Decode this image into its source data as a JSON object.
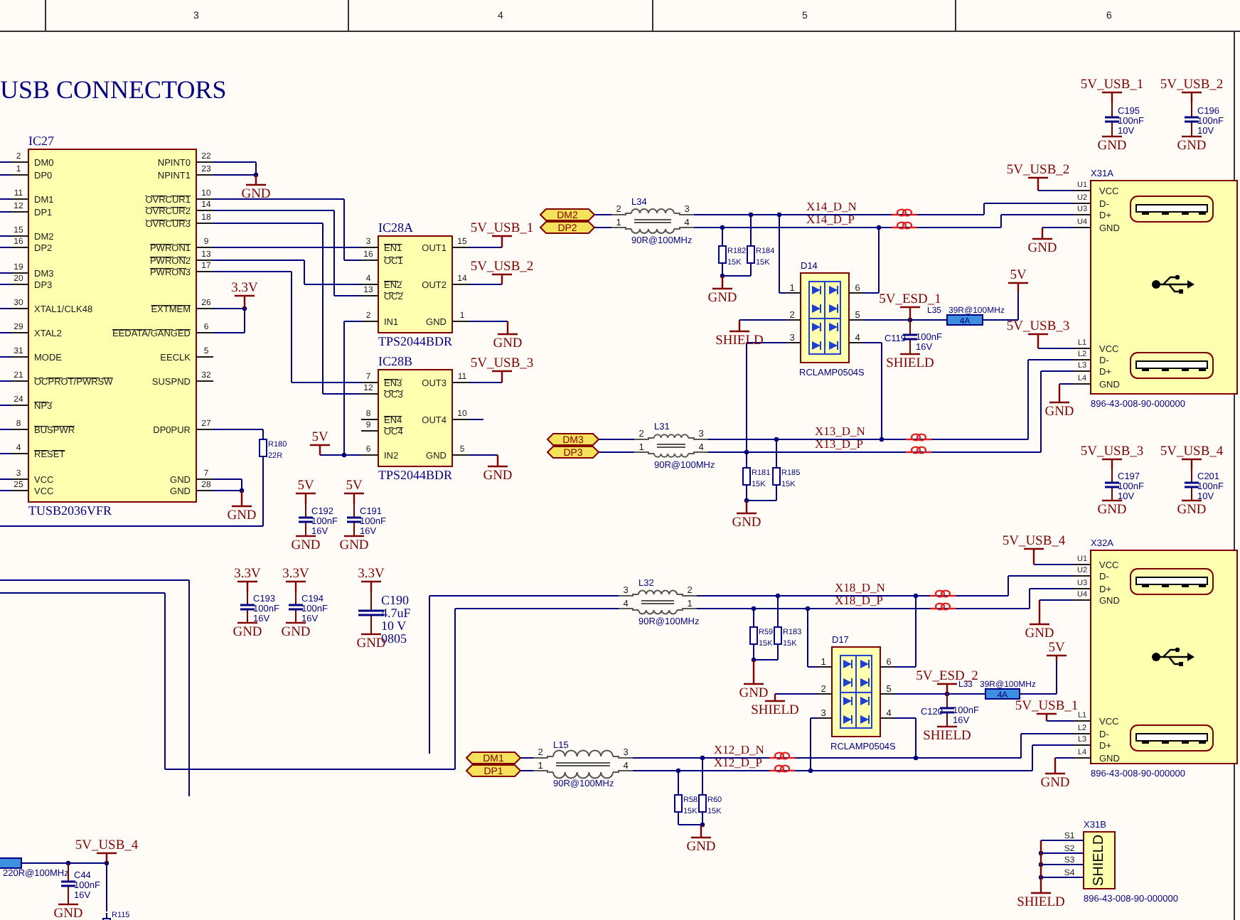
{
  "frame": {
    "column_numbers": [
      "3",
      "4",
      "5",
      "6"
    ]
  },
  "title": "USB CONNECTORS",
  "ics": [
    {
      "designator": "IC27",
      "part_number": "TUSB2036VFR",
      "left_pins": [
        {
          "number": "2",
          "name": "DM0",
          "inverted": false
        },
        {
          "number": "1",
          "name": "DP0",
          "inverted": false
        },
        {
          "number": "11",
          "name": "DM1",
          "inverted": false
        },
        {
          "number": "12",
          "name": "DP1",
          "inverted": false
        },
        {
          "number": "15",
          "name": "DM2",
          "inverted": false
        },
        {
          "number": "16",
          "name": "DP2",
          "inverted": false
        },
        {
          "number": "19",
          "name": "DM3",
          "inverted": false
        },
        {
          "number": "20",
          "name": "DP3",
          "inverted": false
        },
        {
          "number": "30",
          "name": "XTAL1/CLK48",
          "inverted": false
        },
        {
          "number": "29",
          "name": "XTAL2",
          "inverted": false
        },
        {
          "number": "31",
          "name": "MODE",
          "inverted": false
        },
        {
          "number": "21",
          "name": "OCPROT/PWRSW",
          "inverted": true
        },
        {
          "number": "24",
          "name": "NP3",
          "inverted": true
        },
        {
          "number": "8",
          "name": "BUSPWR",
          "inverted": true
        },
        {
          "number": "4",
          "name": "RESET",
          "inverted": true
        },
        {
          "number": "3",
          "name": "VCC",
          "inverted": false
        },
        {
          "number": "25",
          "name": "VCC",
          "inverted": false
        }
      ],
      "right_pins": [
        {
          "number": "22",
          "name": "NPINT0",
          "inverted": false
        },
        {
          "number": "23",
          "name": "NPINT1",
          "inverted": false
        },
        {
          "number": "10",
          "name": "OVRCUR1",
          "inverted": true
        },
        {
          "number": "14",
          "name": "OVRCUR2",
          "inverted": true
        },
        {
          "number": "18",
          "name": "OVRCUR3",
          "inverted": true
        },
        {
          "number": "9",
          "name": "PWRON1",
          "inverted": true
        },
        {
          "number": "13",
          "name": "PWRON2",
          "inverted": true
        },
        {
          "number": "17",
          "name": "PWRON3",
          "inverted": true
        },
        {
          "number": "26",
          "name": "EXTMEM",
          "inverted": true
        },
        {
          "number": "6",
          "name": "EEDATA/GANGED",
          "inverted": true
        },
        {
          "number": "5",
          "name": "EECLK",
          "inverted": false
        },
        {
          "number": "32",
          "name": "SUSPND",
          "inverted": false
        },
        {
          "number": "27",
          "name": "DP0PUR",
          "inverted": false
        },
        {
          "number": "7",
          "name": "GND",
          "inverted": false
        },
        {
          "number": "28",
          "name": "GND",
          "inverted": false
        }
      ]
    },
    {
      "designator": "IC28A",
      "part_number": "TPS2044BDR",
      "left_pins": [
        {
          "number": "3",
          "name": "EN1",
          "inverted": true
        },
        {
          "number": "16",
          "name": "OC1",
          "inverted": true
        },
        {
          "number": "4",
          "name": "EN2",
          "inverted": true
        },
        {
          "number": "13",
          "name": "OC2",
          "inverted": true
        },
        {
          "number": "2",
          "name": "IN1",
          "inverted": false
        }
      ],
      "right_pins": [
        {
          "number": "15",
          "name": "OUT1",
          "inverted": false
        },
        {
          "number": "14",
          "name": "OUT2",
          "inverted": false
        },
        {
          "number": "1",
          "name": "GND",
          "inverted": false
        }
      ]
    },
    {
      "designator": "IC28B",
      "part_number": "TPS2044BDR",
      "left_pins": [
        {
          "number": "7",
          "name": "EN3",
          "inverted": true
        },
        {
          "number": "12",
          "name": "OC3",
          "inverted": true
        },
        {
          "number": "8",
          "name": "EN4",
          "inverted": true
        },
        {
          "number": "9",
          "name": "OC4",
          "inverted": true
        },
        {
          "number": "6",
          "name": "IN2",
          "inverted": false
        }
      ],
      "right_pins": [
        {
          "number": "11",
          "name": "OUT3",
          "inverted": false
        },
        {
          "number": "10",
          "name": "OUT4",
          "inverted": false
        },
        {
          "number": "5",
          "name": "GND",
          "inverted": false
        }
      ]
    }
  ],
  "connectors": [
    {
      "designator": "X31A",
      "part_number": "896-43-008-90-000000",
      "pins": [
        {
          "number": "U1",
          "name": "VCC"
        },
        {
          "number": "U2",
          "name": "D-"
        },
        {
          "number": "U3",
          "name": "D+"
        },
        {
          "number": "U4",
          "name": "GND"
        },
        {
          "number": "L1",
          "name": "VCC"
        },
        {
          "number": "L2",
          "name": "D-"
        },
        {
          "number": "L3",
          "name": "D+"
        },
        {
          "number": "L4",
          "name": "GND"
        }
      ]
    },
    {
      "designator": "X32A",
      "part_number": "896-43-008-90-000000",
      "pins": [
        {
          "number": "U1",
          "name": "VCC"
        },
        {
          "number": "U2",
          "name": "D-"
        },
        {
          "number": "U3",
          "name": "D+"
        },
        {
          "number": "U4",
          "name": "GND"
        },
        {
          "number": "L1",
          "name": "VCC"
        },
        {
          "number": "L2",
          "name": "D-"
        },
        {
          "number": "L3",
          "name": "D+"
        },
        {
          "number": "L4",
          "name": "GND"
        }
      ]
    }
  ],
  "shield_connector": {
    "designator": "X31B",
    "part_number": "896-43-008-90-000000",
    "body_label": "SHIELD",
    "pins": [
      "S1",
      "S2",
      "S3",
      "S4"
    ]
  },
  "chokes": [
    {
      "designator": "L34",
      "value": "90R@100MHz",
      "pins": [
        "2",
        "1",
        "3",
        "4"
      ]
    },
    {
      "designator": "L31",
      "value": "90R@100MHz",
      "pins": [
        "2",
        "1",
        "3",
        "4"
      ]
    },
    {
      "designator": "L32",
      "value": "90R@100MHz",
      "pins": [
        "3",
        "4",
        "2",
        "1"
      ]
    },
    {
      "designator": "L15",
      "value": "90R@100MHz",
      "pins": [
        "2",
        "1",
        "3",
        "4"
      ]
    }
  ],
  "beads": [
    {
      "designator": "L35",
      "value": "39R@100MHz",
      "rating": "4A"
    },
    {
      "designator": "L33",
      "value": "39R@100MHz",
      "rating": "4A"
    },
    {
      "value": "220R@100MHz"
    }
  ],
  "resistors": [
    {
      "designator": "R180",
      "value": "22R"
    },
    {
      "designator": "R182",
      "value": "15K"
    },
    {
      "designator": "R184",
      "value": "15K"
    },
    {
      "designator": "R181",
      "value": "15K"
    },
    {
      "designator": "R185",
      "value": "15K"
    },
    {
      "designator": "R59",
      "value": "15K"
    },
    {
      "designator": "R183",
      "value": "15K"
    },
    {
      "designator": "R58",
      "value": "15K"
    },
    {
      "designator": "R60",
      "value": "15K"
    },
    {
      "designator": "R115"
    }
  ],
  "capacitors": [
    {
      "designator": "C195",
      "value": "100nF",
      "voltage": "10V"
    },
    {
      "designator": "C196",
      "value": "100nF",
      "voltage": "10V"
    },
    {
      "designator": "C192",
      "value": "100nF",
      "voltage": "16V"
    },
    {
      "designator": "C191",
      "value": "100nF",
      "voltage": "16V"
    },
    {
      "designator": "C193",
      "value": "100nF",
      "voltage": "16V"
    },
    {
      "designator": "C194",
      "value": "100nF",
      "voltage": "16V"
    },
    {
      "designator": "C190",
      "value": "4.7uF",
      "voltage": "10 V",
      "package": "0805"
    },
    {
      "designator": "C119",
      "value": "100nF",
      "voltage": "16V"
    },
    {
      "designator": "C120",
      "value": "100nF",
      "voltage": "16V"
    },
    {
      "designator": "C197",
      "value": "100nF",
      "voltage": "10V"
    },
    {
      "designator": "C201",
      "value": "100nF",
      "voltage": "10V"
    },
    {
      "designator": "C44",
      "value": "100nF",
      "voltage": "16V"
    }
  ],
  "diode_arrays": [
    {
      "designator": "D14",
      "part_number": "RCLAMP0504S",
      "left_pins": [
        "1",
        "2",
        "3"
      ],
      "right_pins": [
        "6",
        "5",
        "4"
      ]
    },
    {
      "designator": "D17",
      "part_number": "RCLAMP0504S",
      "left_pins": [
        "1",
        "2",
        "3"
      ],
      "right_pins": [
        "6",
        "5",
        "4"
      ]
    }
  ],
  "power_ports": [
    {
      "kind": "ground",
      "label": "GND"
    },
    {
      "kind": "supply",
      "label": "3.3V"
    },
    {
      "kind": "ground",
      "label": "GND"
    },
    {
      "kind": "supply",
      "label": "5V"
    },
    {
      "kind": "supply",
      "label": "5V_USB_1"
    },
    {
      "kind": "supply",
      "label": "5V_USB_2"
    },
    {
      "kind": "ground",
      "label": "GND"
    },
    {
      "kind": "supply",
      "label": "5V_USB_3"
    },
    {
      "kind": "ground",
      "label": "GND"
    },
    {
      "kind": "supply",
      "label": "5V"
    },
    {
      "kind": "supply",
      "label": "5V"
    },
    {
      "kind": "ground",
      "label": "GND"
    },
    {
      "kind": "ground",
      "label": "GND"
    },
    {
      "kind": "supply",
      "label": "3.3V"
    },
    {
      "kind": "supply",
      "label": "3.3V"
    },
    {
      "kind": "supply",
      "label": "3.3V"
    },
    {
      "kind": "ground",
      "label": "GND"
    },
    {
      "kind": "ground",
      "label": "GND"
    },
    {
      "kind": "ground",
      "label": "GND"
    },
    {
      "kind": "ground",
      "label": "GND"
    },
    {
      "kind": "ground",
      "label": "SHIELD"
    },
    {
      "kind": "supply",
      "label": "5V_ESD_1"
    },
    {
      "kind": "ground",
      "label": "SHIELD"
    },
    {
      "kind": "supply",
      "label": "5V_USB_2"
    },
    {
      "kind": "supply",
      "label": "5V"
    },
    {
      "kind": "ground",
      "label": "GND"
    },
    {
      "kind": "supply",
      "label": "5V_USB_3"
    },
    {
      "kind": "ground",
      "label": "GND"
    },
    {
      "kind": "supply",
      "label": "5V_USB_1"
    },
    {
      "kind": "supply",
      "label": "5V_USB_2"
    },
    {
      "kind": "ground",
      "label": "GND"
    },
    {
      "kind": "ground",
      "label": "GND"
    },
    {
      "kind": "ground",
      "label": "GND"
    },
    {
      "kind": "supply",
      "label": "5V_USB_3"
    },
    {
      "kind": "supply",
      "label": "5V_USB_4"
    },
    {
      "kind": "ground",
      "label": "GND"
    },
    {
      "kind": "ground",
      "label": "GND"
    },
    {
      "kind": "supply",
      "label": "5V_USB_4"
    },
    {
      "kind": "ground",
      "label": "GND"
    },
    {
      "kind": "supply",
      "label": "5V"
    },
    {
      "kind": "ground",
      "label": "GND"
    },
    {
      "kind": "ground",
      "label": "SHIELD"
    },
    {
      "kind": "supply",
      "label": "5V_ESD_2"
    },
    {
      "kind": "ground",
      "label": "SHIELD"
    },
    {
      "kind": "supply",
      "label": "5V_USB_1"
    },
    {
      "kind": "ground",
      "label": "GND"
    },
    {
      "kind": "ground",
      "label": "GND"
    },
    {
      "kind": "ground",
      "label": "SHIELD"
    },
    {
      "kind": "supply",
      "label": "5V_USB_4"
    },
    {
      "kind": "ground",
      "label": "GND"
    }
  ],
  "net_labels": [
    "X14_D_N",
    "X14_D_P",
    "X13_D_N",
    "X13_D_P",
    "X18_D_N",
    "X18_D_P",
    "X12_D_N",
    "X12_D_P"
  ],
  "ports": [
    "DM2",
    "DP2",
    "DM3",
    "DP3",
    "DM1",
    "DP1"
  ]
}
